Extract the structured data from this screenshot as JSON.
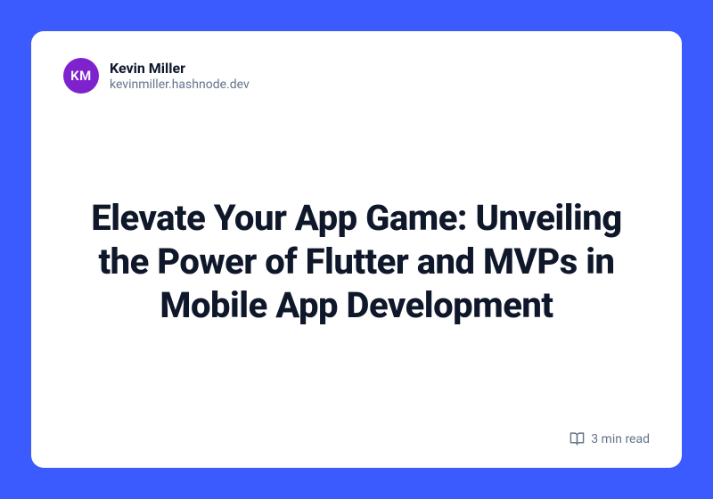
{
  "author": {
    "initials": "KM",
    "name": "Kevin Miller",
    "handle": "kevinmiller.hashnode.dev"
  },
  "article": {
    "title": "Elevate Your App Game: Unveiling the Power of Flutter and MVPs in Mobile App Development",
    "read_time": "3 min read"
  },
  "colors": {
    "frame_bg": "#3B5BFF",
    "avatar_bg": "#7E22CE"
  }
}
